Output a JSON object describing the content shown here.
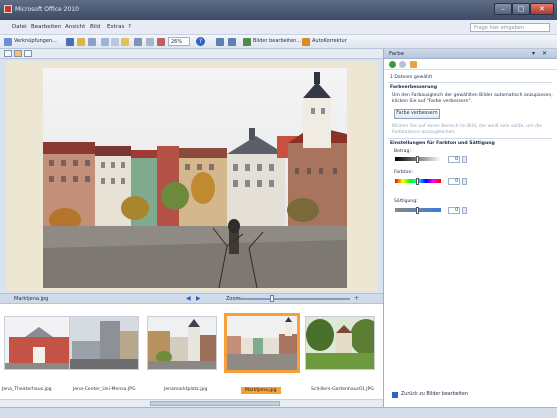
{
  "window": {
    "title": "Microsoft Office 2010",
    "min": "–",
    "max": "▢",
    "close": "✕"
  },
  "menu": {
    "items": [
      "Datei",
      "Bearbeiten",
      "Ansicht",
      "Bild",
      "Extras",
      "?"
    ],
    "help_placeholder": "Frage hier eingeben"
  },
  "toolbar": {
    "shortcuts_label": "Verknüpfungen...",
    "zoom_value": "26%",
    "edit_images_label": "Bilder bearbeiten...",
    "autocorrect_label": "AutoKorrektur"
  },
  "viewer": {
    "filename": "Marktjena.jpg",
    "zoom_label": "Zoom:"
  },
  "filmstrip": {
    "items": [
      {
        "label": "Jena_Theaterhaus.jpg"
      },
      {
        "label": "Jena-Center_Uni-Mensa.JPG"
      },
      {
        "label": "Jenamarktplatz.jpg"
      },
      {
        "label": "Marktjena.jpg",
        "selected": true
      },
      {
        "label": "Schillers-Gartenhaus01.JPG"
      }
    ]
  },
  "taskpane": {
    "title": "Farbe",
    "selected_count": "1 Dateien gewählt",
    "section_colorfix": "Farbverbesserung",
    "colorfix_desc_1": "Um den Farbausgleich der gewählten Bilder automatisch anzupassen,",
    "colorfix_desc_2": "klicken Sie auf \"Farbe verbessern\".",
    "improve_button": "Farbe verbessern",
    "hint_1": "Klicken Sie auf einen Bereich im Bild, der weiß sein sollte, um die",
    "hint_2": "Farbbalance auszugleichen.",
    "section_tone": "Einstellungen für Farbton und Sättigung",
    "slider_amount": {
      "label": "Betrag:",
      "value": "0"
    },
    "slider_hue": {
      "label": "Farbton:",
      "value": "0"
    },
    "slider_saturation": {
      "label": "Sättigung:",
      "value": "0"
    },
    "back_link": "Zurück zu Bilder bearbeiten"
  },
  "colors": {
    "accent": "#f5a03a",
    "titlebar": "#4a5672",
    "pane_bg": "#d9e2ef"
  }
}
